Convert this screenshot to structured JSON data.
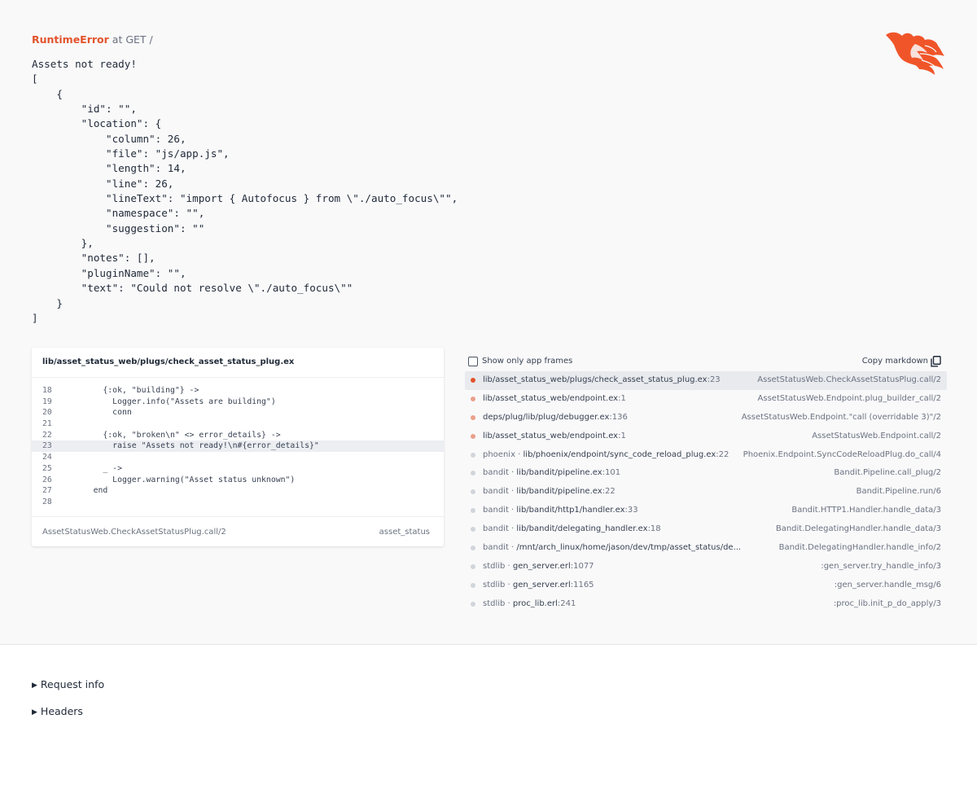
{
  "error": {
    "type": "RuntimeError",
    "route": " at GET /",
    "message": "Assets not ready!\n[\n    {\n        \"id\": \"\",\n        \"location\": {\n            \"column\": 26,\n            \"file\": \"js/app.js\",\n            \"length\": 14,\n            \"line\": 26,\n            \"lineText\": \"import { Autofocus } from \\\"./auto_focus\\\"\",\n            \"namespace\": \"\",\n            \"suggestion\": \"\"\n        },\n        \"notes\": [],\n        \"pluginName\": \"\",\n        \"text\": \"Could not resolve \\\"./auto_focus\\\"\"\n    }\n]"
  },
  "colors": {
    "accent": "#e2532c",
    "dot_app": "#e2532c",
    "dot_app_light": "#eaa08a",
    "dot_dep": "#d1d5db"
  },
  "source": {
    "file": "lib/asset_status_web/plugs/check_asset_status_plug.ex",
    "lines": [
      {
        "n": "18",
        "code": "      {:ok, \"building\"} ->",
        "highlight": false
      },
      {
        "n": "19",
        "code": "        Logger.info(\"Assets are building\")",
        "highlight": false
      },
      {
        "n": "20",
        "code": "        conn",
        "highlight": false
      },
      {
        "n": "21",
        "code": "",
        "highlight": false
      },
      {
        "n": "22",
        "code": "      {:ok, \"broken\\n\" <> error_details} ->",
        "highlight": false
      },
      {
        "n": "23",
        "code": "        raise \"Assets not ready!\\n#{error_details}\"",
        "highlight": true
      },
      {
        "n": "24",
        "code": "",
        "highlight": false
      },
      {
        "n": "25",
        "code": "      _ ->",
        "highlight": false
      },
      {
        "n": "26",
        "code": "        Logger.warning(\"Asset status unknown\")",
        "highlight": false
      },
      {
        "n": "27",
        "code": "    end",
        "highlight": false
      },
      {
        "n": "28",
        "code": "",
        "highlight": false
      }
    ],
    "function": "AssetStatusWeb.CheckAssetStatusPlug.call/2",
    "app": "asset_status"
  },
  "frames_header": {
    "show_only_app_frames": "Show only app frames",
    "copy_markdown": "Copy markdown",
    "copy_icon": "copy-icon"
  },
  "frames": [
    {
      "lib": "",
      "file": "lib/asset_status_web/plugs/check_asset_status_plug.ex",
      "line": ":23",
      "func": "AssetStatusWeb.CheckAssetStatusPlug.call/2",
      "kind": "app",
      "selected": true
    },
    {
      "lib": "",
      "file": "lib/asset_status_web/endpoint.ex",
      "line": ":1",
      "func": "AssetStatusWeb.Endpoint.plug_builder_call/2",
      "kind": "app_light",
      "selected": false
    },
    {
      "lib": "",
      "file": "deps/plug/lib/plug/debugger.ex",
      "line": ":136",
      "func": "AssetStatusWeb.Endpoint.\"call (overridable 3)\"/2",
      "kind": "app_light",
      "selected": false
    },
    {
      "lib": "",
      "file": "lib/asset_status_web/endpoint.ex",
      "line": ":1",
      "func": "AssetStatusWeb.Endpoint.call/2",
      "kind": "app_light",
      "selected": false
    },
    {
      "lib": "phoenix · ",
      "file": "lib/phoenix/endpoint/sync_code_reload_plug.ex",
      "line": ":22",
      "func": "Phoenix.Endpoint.SyncCodeReloadPlug.do_call/4",
      "kind": "dep",
      "selected": false
    },
    {
      "lib": "bandit · ",
      "file": "lib/bandit/pipeline.ex",
      "line": ":101",
      "func": "Bandit.Pipeline.call_plug/2",
      "kind": "dep",
      "selected": false
    },
    {
      "lib": "bandit · ",
      "file": "lib/bandit/pipeline.ex",
      "line": ":22",
      "func": "Bandit.Pipeline.run/6",
      "kind": "dep",
      "selected": false
    },
    {
      "lib": "bandit · ",
      "file": "lib/bandit/http1/handler.ex",
      "line": ":33",
      "func": "Bandit.HTTP1.Handler.handle_data/3",
      "kind": "dep",
      "selected": false
    },
    {
      "lib": "bandit · ",
      "file": "lib/bandit/delegating_handler.ex",
      "line": ":18",
      "func": "Bandit.DelegatingHandler.handle_data/3",
      "kind": "dep",
      "selected": false
    },
    {
      "lib": "bandit · ",
      "file": "/mnt/arch_linux/home/jason/dev/tmp/asset_status/de...",
      "line": "",
      "func": "Bandit.DelegatingHandler.handle_info/2",
      "kind": "dep",
      "selected": false
    },
    {
      "lib": "stdlib · ",
      "file": "gen_server.erl",
      "line": ":1077",
      "func": ":gen_server.try_handle_info/3",
      "kind": "dep",
      "selected": false
    },
    {
      "lib": "stdlib · ",
      "file": "gen_server.erl",
      "line": ":1165",
      "func": ":gen_server.handle_msg/6",
      "kind": "dep",
      "selected": false
    },
    {
      "lib": "stdlib · ",
      "file": "proc_lib.erl",
      "line": ":241",
      "func": ":proc_lib.init_p_do_apply/3",
      "kind": "dep",
      "selected": false
    }
  ],
  "sections": {
    "request_info": "Request info",
    "headers": "Headers"
  }
}
